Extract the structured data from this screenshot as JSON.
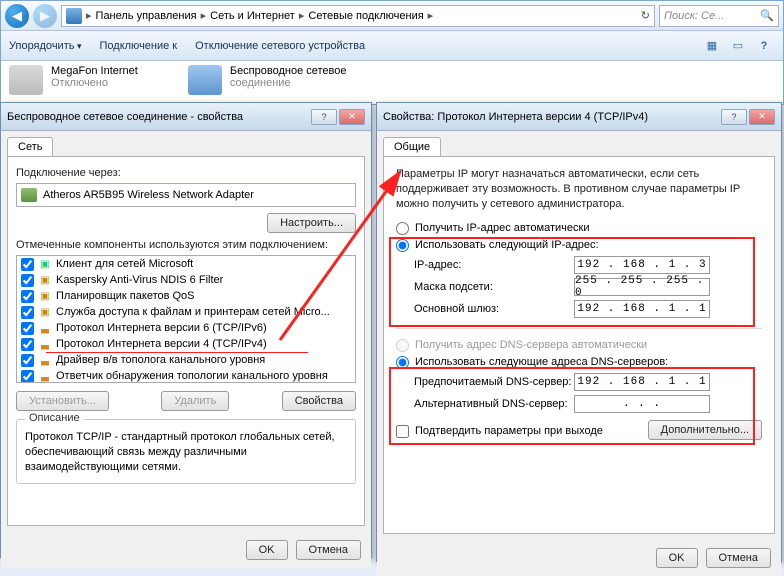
{
  "breadcrumb": {
    "p1": "Панель управления",
    "p2": "Сеть и Интернет",
    "p3": "Сетевые подключения"
  },
  "search": {
    "placeholder": "Поиск: Се..."
  },
  "toolbar": {
    "organize": "Упорядочить",
    "connect": "Подключение к",
    "disable": "Отключение сетевого устройства"
  },
  "connections": {
    "c1": {
      "name": "MegaFon Internet",
      "status": "Отключено"
    },
    "c2": {
      "name": "Беспроводное сетевое",
      "status": "соединение"
    }
  },
  "left": {
    "title": "Беспроводное сетевое соединение - свойства",
    "tab": "Сеть",
    "connect_via": "Подключение через:",
    "adapter": "Atheros AR5B95 Wireless Network Adapter",
    "configure": "Настроить...",
    "components_label": "Отмеченные компоненты используются этим подключением:",
    "comp": {
      "c0": "Клиент для сетей Microsoft",
      "c1": "Kaspersky Anti-Virus NDIS 6 Filter",
      "c2": "Планировщик пакетов QoS",
      "c3": "Служба доступа к файлам и принтерам сетей Micro...",
      "c4": "Протокол Интернета версии 6 (TCP/IPv6)",
      "c5": "Протокол Интернета версии 4 (TCP/IPv4)",
      "c6": "Драйвер в/в тополога канального уровня",
      "c7": "Ответчик обнаружения топологии канального уровня"
    },
    "install": "Установить...",
    "remove": "Удалить",
    "props": "Свойства",
    "desc_head": "Описание",
    "desc": "Протокол TCP/IP - стандартный протокол глобальных сетей, обеспечивающий связь между различными взаимодействующими сетями.",
    "ok": "OK",
    "cancel": "Отмена"
  },
  "right": {
    "title": "Свойства: Протокол Интернета версии 4 (TCP/IPv4)",
    "tab": "Общие",
    "desc": "Параметры IP могут назначаться автоматически, если сеть поддерживает эту возможность. В противном случае параметры IP можно получить у сетевого администратора.",
    "r1": "Получить IP-адрес автоматически",
    "r2": "Использовать следующий IP-адрес:",
    "ip_l": "IP-адрес:",
    "ip_v": "192 . 168 .  1  .  3",
    "mask_l": "Маска подсети:",
    "mask_v": "255 . 255 . 255 .  0",
    "gw_l": "Основной шлюз:",
    "gw_v": "192 . 168 .  1  .  1",
    "r3": "Получить адрес DNS-сервера автоматически",
    "r4": "Использовать следующие адреса DNS-серверов:",
    "dns1_l": "Предпочитаемый DNS-сервер:",
    "dns1_v": "192 . 168 .  1  .  1",
    "dns2_l": "Альтернативный DNS-сервер:",
    "dns2_v": " .     .     . ",
    "validate": "Подтвердить параметры при выходе",
    "advanced": "Дополнительно...",
    "ok": "OK",
    "cancel": "Отмена"
  }
}
